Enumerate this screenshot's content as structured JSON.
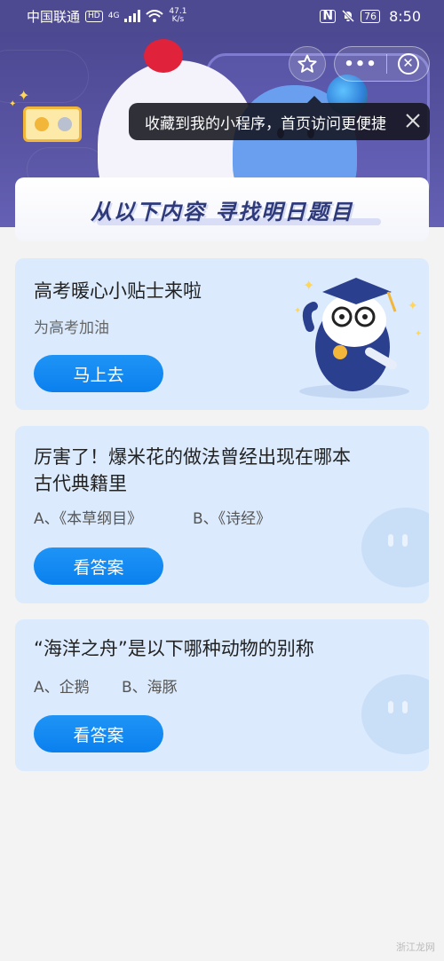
{
  "status_bar": {
    "carrier": "中国联通",
    "hd": "HD",
    "network": "4G",
    "speed_value": "47.1",
    "speed_unit": "K/s",
    "battery": "76",
    "time": "8:50"
  },
  "tooltip": {
    "text": "收藏到我的小程序，首页访问更便捷"
  },
  "capsule": {
    "more": "•••"
  },
  "section": {
    "title": "从以下内容 寻找明日题目"
  },
  "cards": [
    {
      "title": "高考暖心小贴士来啦",
      "subtitle": "为高考加油",
      "button": "马上去"
    },
    {
      "title_line1": "厉害了！爆米花的做法曾经出现在哪本",
      "title_line2": "古代典籍里",
      "option_a": "A、《本草纲目》",
      "option_b": "B、《诗经》",
      "button": "看答案"
    },
    {
      "title": "“海洋之舟”是以下哪种动物的别称",
      "option_a": "A、企鹅",
      "option_b": "B、海豚",
      "button": "看答案"
    }
  ],
  "watermark": "浙江龙网",
  "colors": {
    "header": "#4e4a92",
    "card": "#dbeafc",
    "button": "#1389f2",
    "page": "#f3f3f4"
  }
}
